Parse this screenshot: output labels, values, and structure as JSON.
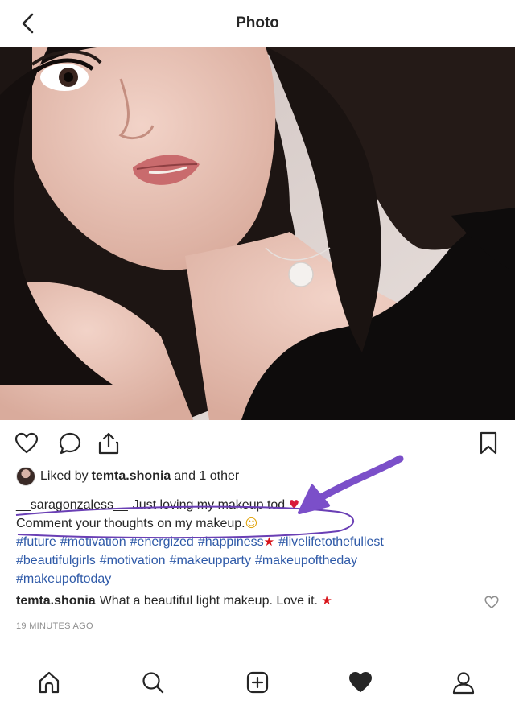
{
  "header": {
    "title": "Photo",
    "back_icon": "chevron-left-icon"
  },
  "post": {
    "actions": {
      "like_icon": "heart-outline-icon",
      "comment_icon": "comment-bubble-icon",
      "share_icon": "share-upload-icon",
      "save_icon": "bookmark-icon"
    },
    "likes": {
      "prefix": "Liked by",
      "user": "temta.shonia",
      "suffix": "and 1 other"
    },
    "caption": {
      "username": "__saragonzaless__",
      "text": "Just loving my makeup tod",
      "line2": "Comment your thoughts on my makeup.",
      "emoji_smile": "☺",
      "emoji_star_eyes": "★",
      "emoji_heart": "♥",
      "hashtags_line1": [
        "#future",
        "#motivation",
        "#energized",
        "#happiness"
      ],
      "hashtags_line1_end": "#livelifetothefullest",
      "hashtags_line2": [
        "#beautifulgirls",
        "#motivation",
        "#makeupparty",
        "#makeupoftheday"
      ],
      "hashtags_line3": [
        "#makeupoftoday"
      ]
    },
    "comment": {
      "username": "temta.shonia",
      "text": "What a beautiful light makeup. Love it.",
      "emoji": "★"
    },
    "timestamp": "19 MINUTES AGO"
  },
  "bottom_nav": {
    "items": [
      "home-icon",
      "search-icon",
      "add-post-icon",
      "activity-heart-icon",
      "profile-icon"
    ]
  },
  "colors": {
    "hashtag": "#2f5aa8",
    "annotation_purple": "#7b4fc9",
    "text": "#262626",
    "muted": "#8e8e8e"
  }
}
